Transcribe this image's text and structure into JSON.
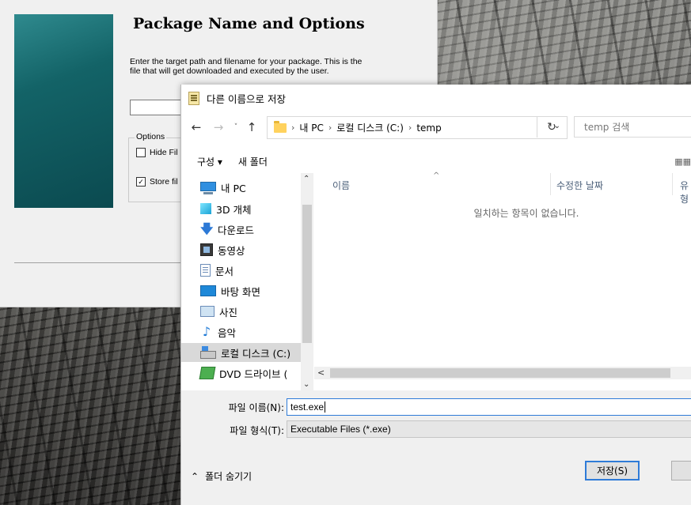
{
  "installer": {
    "heading": "Package Name and Options",
    "description": "Enter the target path and filename for your package. This is the file that will get downloaded and executed by the user.",
    "options_legend": "Options",
    "option_hide": "Hide Fil",
    "option_store": "Store fil",
    "option_store_checked": "✓"
  },
  "dialog": {
    "title": "다른 이름으로 저장",
    "nav": {
      "back": "←",
      "forward": "→",
      "recent": "˅",
      "up": "↑",
      "refresh": "↻"
    },
    "breadcrumb": [
      "내 PC",
      "로컬 디스크 (C:)",
      "temp"
    ],
    "breadcrumb_sep": "›",
    "search_placeholder": "temp 검색",
    "toolbar": {
      "organize": "구성 ▾",
      "new_folder": "새 폴더"
    },
    "nav_pane": [
      {
        "label": "내 PC",
        "icon": "pc-icon"
      },
      {
        "label": "3D 개체",
        "icon": "3d-objects-icon"
      },
      {
        "label": "다운로드",
        "icon": "download-icon"
      },
      {
        "label": "동영상",
        "icon": "video-icon"
      },
      {
        "label": "문서",
        "icon": "document-icon"
      },
      {
        "label": "바탕 화면",
        "icon": "desktop-icon"
      },
      {
        "label": "사진",
        "icon": "pictures-icon"
      },
      {
        "label": "음악",
        "icon": "music-icon"
      },
      {
        "label": "로컬 디스크 (C:)",
        "icon": "local-disk-icon",
        "selected": true
      },
      {
        "label": "DVD 드라이브 (",
        "icon": "dvd-drive-icon"
      }
    ],
    "columns": {
      "name": "이름",
      "date_modified": "수정한 날짜",
      "type": "유형"
    },
    "empty_message": "일치하는 항목이 없습니다.",
    "file_name_label": "파일 이름(N):",
    "file_name_value": "test.exe",
    "file_type_label": "파일 형식(T):",
    "file_type_value": "Executable Files (*.exe)",
    "hide_folders": "폴더 숨기기",
    "save_button": "저장(S)",
    "cancel_button": ""
  },
  "colors": {
    "accent": "#2f7bd8",
    "banner": "#136367",
    "folder": "#ffd25e"
  }
}
